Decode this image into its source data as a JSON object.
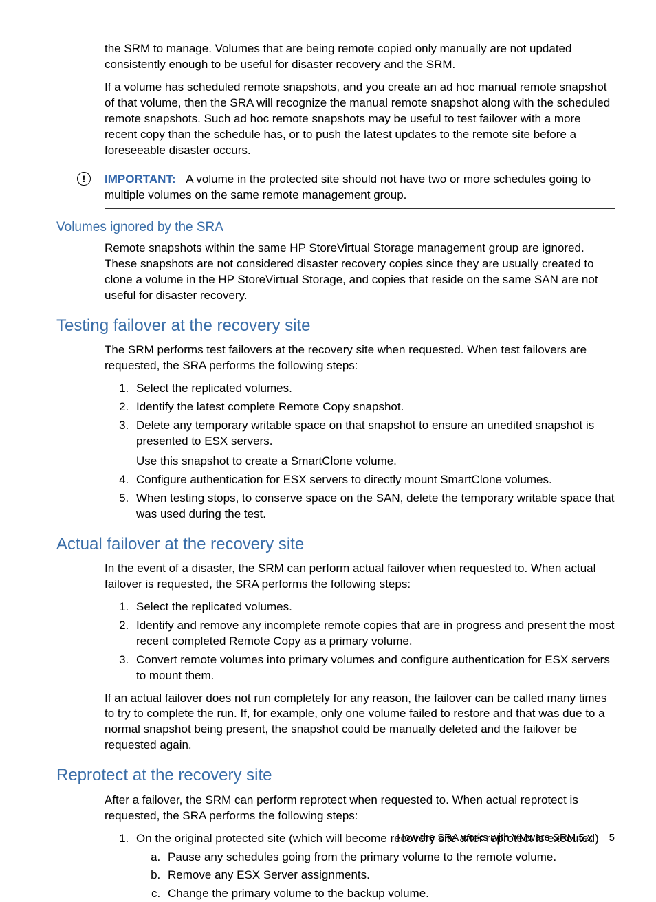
{
  "intro": {
    "p1": "the SRM to manage. Volumes that are being remote copied only manually are not updated consistently enough to be useful for disaster recovery and the SRM.",
    "p2": "If a volume has scheduled remote snapshots, and you create an ad hoc manual remote snapshot of that volume, then the SRA will recognize the manual remote snapshot along with the scheduled remote snapshots. Such ad hoc remote snapshots may be useful to test failover with a more recent copy than the schedule has, or to push the latest updates to the remote site before a foreseeable disaster occurs."
  },
  "important": {
    "label": "IMPORTANT:",
    "text": "A volume in the protected site should not have two or more schedules going to multiple volumes on the same remote management group."
  },
  "sec_ignored": {
    "title": "Volumes ignored by the SRA",
    "p1": "Remote snapshots within the same HP StoreVirtual Storage management group are ignored. These snapshots are not considered disaster recovery copies since they are usually created to clone a volume in the HP StoreVirtual Storage, and copies that reside on the same SAN are not useful for disaster recovery."
  },
  "sec_testing": {
    "title": "Testing failover at the recovery site",
    "p1": "The SRM performs test failovers at the recovery site when requested. When test failovers are requested, the SRA performs the following steps:",
    "steps": {
      "s1": "Select the replicated volumes.",
      "s2": "Identify the latest complete Remote Copy snapshot.",
      "s3": "Delete any temporary writable space on that snapshot to ensure an unedited snapshot is presented to ESX servers.",
      "s3b": "Use this snapshot to create a SmartClone volume.",
      "s4": "Configure authentication for ESX servers to directly mount SmartClone volumes.",
      "s5": "When testing stops, to conserve space on the SAN, delete the temporary writable space that was used during the test."
    }
  },
  "sec_actual": {
    "title": "Actual failover at the recovery site",
    "p1": "In the event of a disaster, the SRM can perform actual failover when requested to. When actual failover is requested, the SRA performs the following steps:",
    "steps": {
      "s1": "Select the replicated volumes.",
      "s2": "Identify and remove any incomplete remote copies that are in progress and present the most recent completed Remote Copy as a primary volume.",
      "s3": "Convert remote volumes into primary volumes and configure authentication for ESX servers to mount them."
    },
    "p2": "If an actual failover does not run completely for any reason, the failover can be called many times to try to complete the run. If, for example, only one volume failed to restore and that was due to a normal snapshot being present, the snapshot could be manually deleted and the failover be requested again."
  },
  "sec_reprotect": {
    "title": "Reprotect at the recovery site",
    "p1": "After a failover, the SRM can perform reprotect when requested to. When actual reprotect is requested, the SRA performs the following steps:",
    "step1": "On the original protected site (which will become recovery site after reprotect is executed)",
    "sub": {
      "a": "Pause any schedules going from the primary volume to the remote volume.",
      "b": "Remove any ESX Server assignments.",
      "c": "Change the primary volume to the backup volume."
    }
  },
  "footer": {
    "text": "How the SRA works with VMware SRM 5.x",
    "page": "5"
  }
}
